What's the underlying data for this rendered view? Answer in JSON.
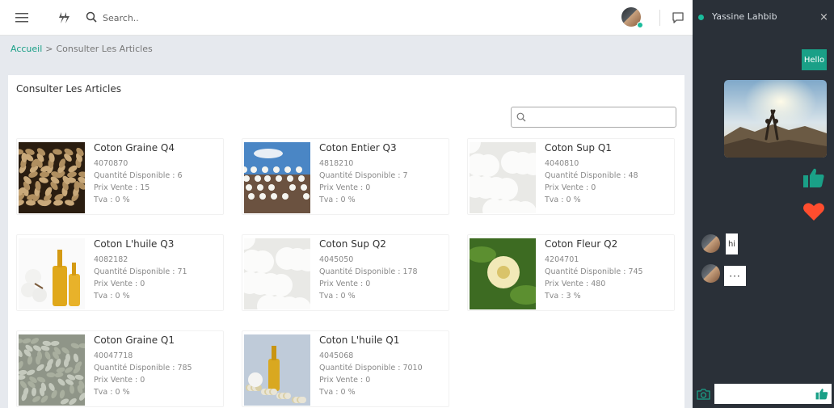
{
  "header": {
    "search_placeholder": "Search.."
  },
  "breadcrumb": {
    "home": "Accueil",
    "separator": ">",
    "current": "Consulter Les Articles"
  },
  "card": {
    "title": "Consulter Les Articles",
    "filter_value": ""
  },
  "labels": {
    "qty": "Quantité Disponible : ",
    "price": "Prix Vente : ",
    "tva": "Tva : "
  },
  "products": [
    {
      "name": "Coton Graine Q4",
      "code": "4070870",
      "qty": "6",
      "price": "15",
      "tva": "0 %",
      "image": "seeds-brown"
    },
    {
      "name": "Coton Entier Q3",
      "code": "4818210",
      "qty": "7",
      "price": "0",
      "tva": "0 %",
      "image": "cotton-field"
    },
    {
      "name": "Coton Sup Q1",
      "code": "4040810",
      "qty": "48",
      "price": "0",
      "tva": "0 %",
      "image": "cotton-white"
    },
    {
      "name": "Coton L'huile Q3",
      "code": "4082182",
      "qty": "71",
      "price": "0",
      "tva": "0 %",
      "image": "oil-bottles"
    },
    {
      "name": "Coton Sup Q2",
      "code": "4045050",
      "qty": "178",
      "price": "0",
      "tva": "0 %",
      "image": "cotton-white"
    },
    {
      "name": "Coton Fleur Q2",
      "code": "4204701",
      "qty": "745",
      "price": "480",
      "tva": "3 %",
      "image": "cotton-flower"
    },
    {
      "name": "Coton Graine Q1",
      "code": "40047718",
      "qty": "785",
      "price": "0",
      "tva": "0 %",
      "image": "seeds-grey"
    },
    {
      "name": "Coton L'huile Q1",
      "code": "4045068",
      "qty": "7010",
      "price": "0",
      "tva": "0 %",
      "image": "oil-seeds"
    }
  ],
  "chat": {
    "user": "Yassine Lahbib",
    "close": "×",
    "messages": {
      "sent_text": "Hello",
      "received_text": "hi",
      "typing": "···"
    },
    "input_value": ""
  },
  "colors": {
    "accent": "#1aa087",
    "chat_bg": "#2a3038",
    "heart": "#ff4d2e"
  }
}
